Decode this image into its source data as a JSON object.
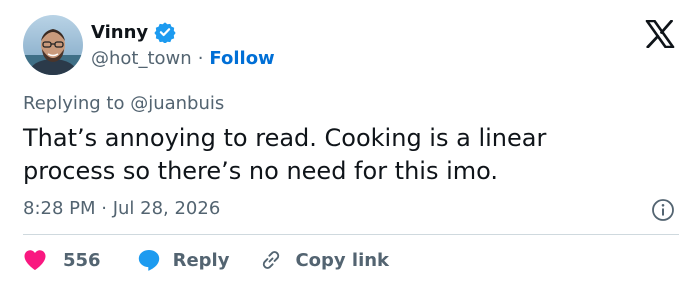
{
  "author": {
    "name": "Vinny",
    "handle": "@hot_town",
    "separator": "·",
    "follow_label": "Follow"
  },
  "tweet": {
    "replying_prefix": "Replying to ",
    "replying_to": "@juanbuis",
    "text": "That’s annoying to read. Cooking is a linear process so there’s no need for this imo.",
    "timestamp": "8:28 PM · Jul 28, 2026"
  },
  "actions": {
    "like_count": "556",
    "reply_label": "Reply",
    "copy_label": "Copy link"
  },
  "icons": {
    "verified": "verified-badge-icon",
    "logo": "x-logo-icon",
    "info": "info-icon",
    "like": "heart-icon",
    "reply": "speech-bubble-icon",
    "copy": "link-icon"
  },
  "colors": {
    "like": "#f91880",
    "reply": "#1d9bf0",
    "link": "#006fd6",
    "verified": "#1d9bf0",
    "secondary_text": "#536471"
  }
}
